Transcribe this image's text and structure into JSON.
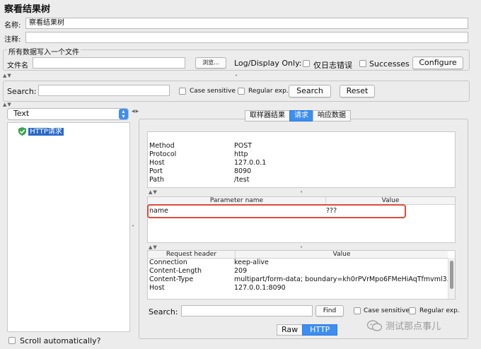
{
  "window": {
    "title": "察看结果树"
  },
  "form": {
    "name_label": "名称:",
    "name_value": "察看结果树",
    "comment_label": "注释:",
    "comment_value": ""
  },
  "file_section": {
    "legend": "所有数据写入一个文件",
    "filename_label": "文件名",
    "filename_value": "",
    "browse_label": "浏览...",
    "log_display_label": "Log/Display Only:",
    "errors_only_label": "仅日志错误",
    "successes_label": "Successes",
    "configure_label": "Configure"
  },
  "search_bar": {
    "label": "Search:",
    "value": "",
    "case_sensitive_label": "Case sensitive",
    "regex_label": "Regular exp.",
    "search_button": "Search",
    "reset_button": "Reset"
  },
  "left_panel": {
    "renderer_selected": "Text",
    "tree_items": [
      {
        "label": "HTTP请求",
        "status_color": "#3aa64a"
      }
    ],
    "scroll_auto_label": "Scroll automatically?"
  },
  "result_tabs": [
    {
      "label": "取样器结果",
      "active": false
    },
    {
      "label": "请求",
      "active": true
    },
    {
      "label": "响应数据",
      "active": false
    }
  ],
  "request_info": [
    {
      "key": "Method",
      "value": "POST"
    },
    {
      "key": "Protocol",
      "value": "http"
    },
    {
      "key": "Host",
      "value": "127.0.0.1"
    },
    {
      "key": "Port",
      "value": "8090"
    },
    {
      "key": "Path",
      "value": "/test"
    }
  ],
  "params_table": {
    "headers": [
      "Parameter name",
      "Value"
    ],
    "rows": [
      {
        "name": "name",
        "value": "???"
      }
    ]
  },
  "headers_table": {
    "headers": [
      "Request header",
      "Value"
    ],
    "rows": [
      {
        "name": "Connection",
        "value": "keep-alive"
      },
      {
        "name": "Content-Length",
        "value": "209"
      },
      {
        "name": "Content-Type",
        "value": "multipart/form-data; boundary=kh0rPVrMpo6FMeHiAqTfmvml3..."
      },
      {
        "name": "Host",
        "value": "127.0.0.1:8090"
      }
    ]
  },
  "inner_search": {
    "label": "Search:",
    "value": "",
    "find_button": "Find",
    "case_sensitive_label": "Case sensitive",
    "regex_label": "Regular exp."
  },
  "bottom_tabs": [
    {
      "label": "Raw",
      "active": false
    },
    {
      "label": "HTTP",
      "active": true
    }
  ],
  "watermark": "测试那点事儿",
  "accent_color": "#3d8ef0",
  "highlight_color": "#e04a3a"
}
